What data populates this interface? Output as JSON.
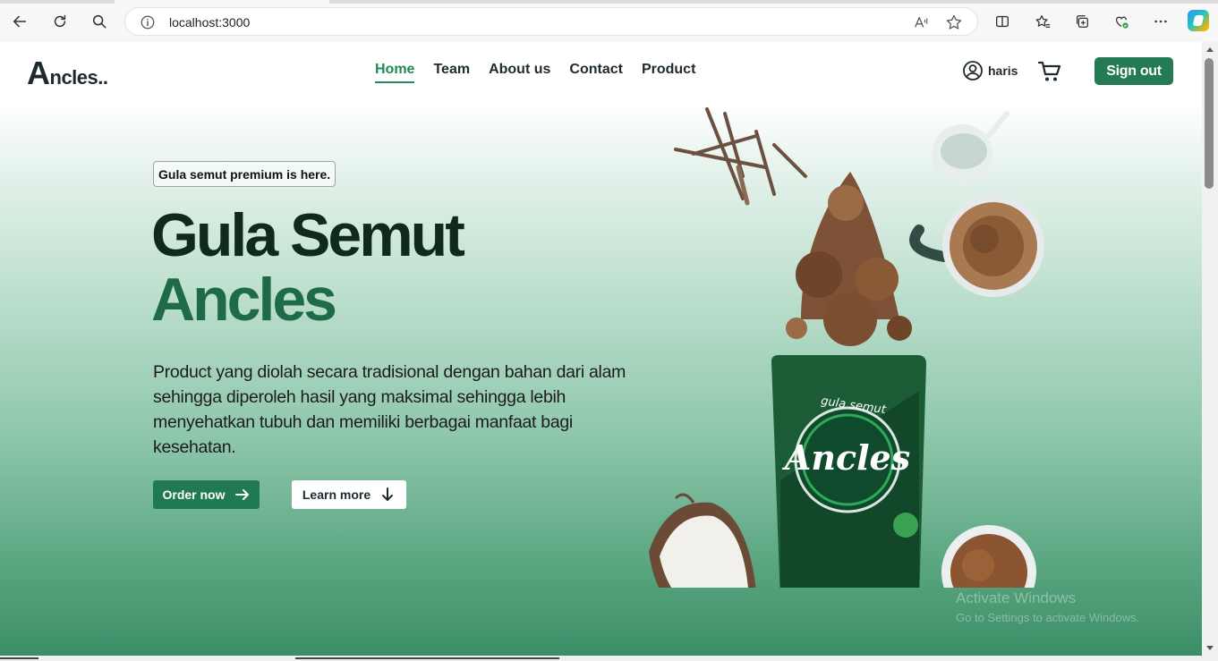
{
  "browser": {
    "url": "localhost:3000"
  },
  "navbar": {
    "logo_initial": "A",
    "logo_rest": "ncles..",
    "links": [
      {
        "label": "Home",
        "active": true
      },
      {
        "label": "Team",
        "active": false
      },
      {
        "label": "About us",
        "active": false
      },
      {
        "label": "Contact",
        "active": false
      },
      {
        "label": "Product",
        "active": false
      }
    ],
    "user_name": "haris",
    "signout_label": "Sign out"
  },
  "hero": {
    "badge": "Gula semut premium is here.",
    "title_line1": "Gula Semut",
    "title_line2": "Ancles",
    "description": "Product yang diolah secara tradisional dengan bahan dari alam sehingga diperoleh hasil yang maksimal sehingga lebih menyehatkan tubuh dan memiliki berbagai manfaat bagi kesehatan.",
    "order_label": "Order now",
    "learn_label": "Learn more"
  },
  "product": {
    "pouch_brand": "Ancles",
    "pouch_sub": "gula semut"
  },
  "watermark": {
    "line1": "Activate Windows",
    "line2": "Go to Settings to activate Windows."
  },
  "colors": {
    "accent": "#1f7a52",
    "title_dark": "#0e2a1e",
    "title_green": "#1f6b47"
  }
}
